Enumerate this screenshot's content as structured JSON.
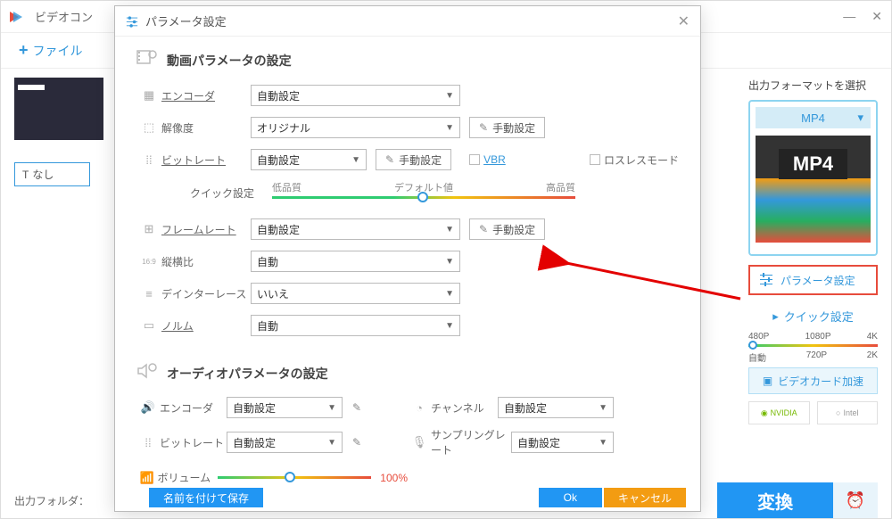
{
  "main": {
    "title": "ビデオコン",
    "add_file": "ファイル",
    "thumb_label": "なし",
    "output_folder_label": "出力フォルダ：",
    "convert": "変換"
  },
  "sidebar": {
    "format_select_title": "出力フォーマットを選択",
    "format": "MP4",
    "format_icon_label": "MP4",
    "param_button": "パラメータ設定",
    "quick_title": "クイック設定",
    "quality_labels_top": [
      "480P",
      "1080P",
      "4K"
    ],
    "quality_labels_bottom": [
      "自動",
      "720P",
      "2K"
    ],
    "gpu_label": "ビデオカード加速",
    "nvidia": "NVIDIA",
    "intel": "Intel"
  },
  "dialog": {
    "title": "パラメータ設定",
    "video_section": "動画パラメータの設定",
    "audio_section": "オーディオパラメータの設定",
    "encoder": "エンコーダ",
    "encoder_val": "自動設定",
    "resolution": "解像度",
    "resolution_val": "オリジナル",
    "manual_setting": "手動設定",
    "bitrate": "ビットレート",
    "bitrate_val": "自動設定",
    "vbr": "VBR",
    "lossless": "ロスレスモード",
    "quick_setting": "クイック設定",
    "low_quality": "低品質",
    "default_val": "デフォルト値",
    "high_quality": "高品質",
    "framerate": "フレームレート",
    "framerate_val": "自動設定",
    "aspect": "縦横比",
    "aspect_val": "自動",
    "deinterlace": "デインターレース",
    "deinterlace_val": "いいえ",
    "norm": "ノルム",
    "norm_val": "自動",
    "a_encoder": "エンコーダ",
    "a_encoder_val": "自動設定",
    "a_channel": "チャンネル",
    "a_channel_val": "自動設定",
    "a_bitrate": "ビットレート",
    "a_bitrate_val": "自動設定",
    "a_sample": "サンプリングレート",
    "a_sample_val": "自動設定",
    "a_volume": "ボリューム",
    "a_volume_val": "100%",
    "save_as": "名前を付けて保存",
    "ok": "Ok",
    "cancel": "キャンセル"
  }
}
